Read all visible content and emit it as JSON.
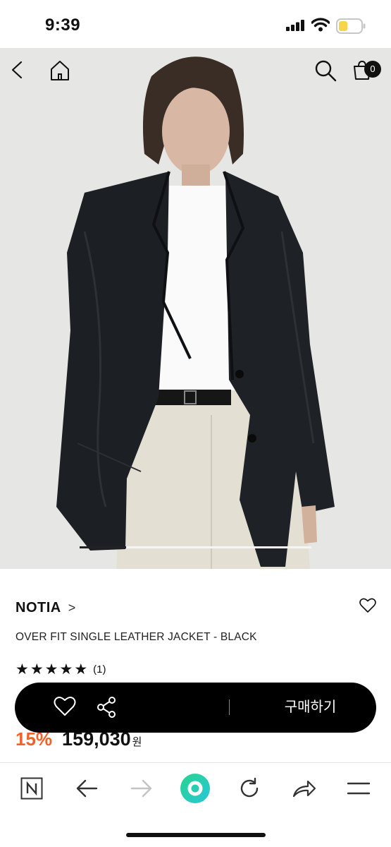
{
  "status_bar": {
    "time": "9:39"
  },
  "nav": {
    "cart_count": "0"
  },
  "gallery": {
    "current_index": 1,
    "total": 5
  },
  "product": {
    "brand": "NOTIA",
    "brand_chevron": ">",
    "name": "OVER FIT SINGLE LEATHER JACKET - BLACK",
    "rating_stars": 5,
    "review_count": "(1)",
    "discount": "15%",
    "price": "159,030",
    "currency": "원"
  },
  "buy_bar": {
    "buy_label": "구매하기"
  },
  "colors": {
    "accent": "#f0622b",
    "bar": "#000000",
    "text": "#111111"
  }
}
